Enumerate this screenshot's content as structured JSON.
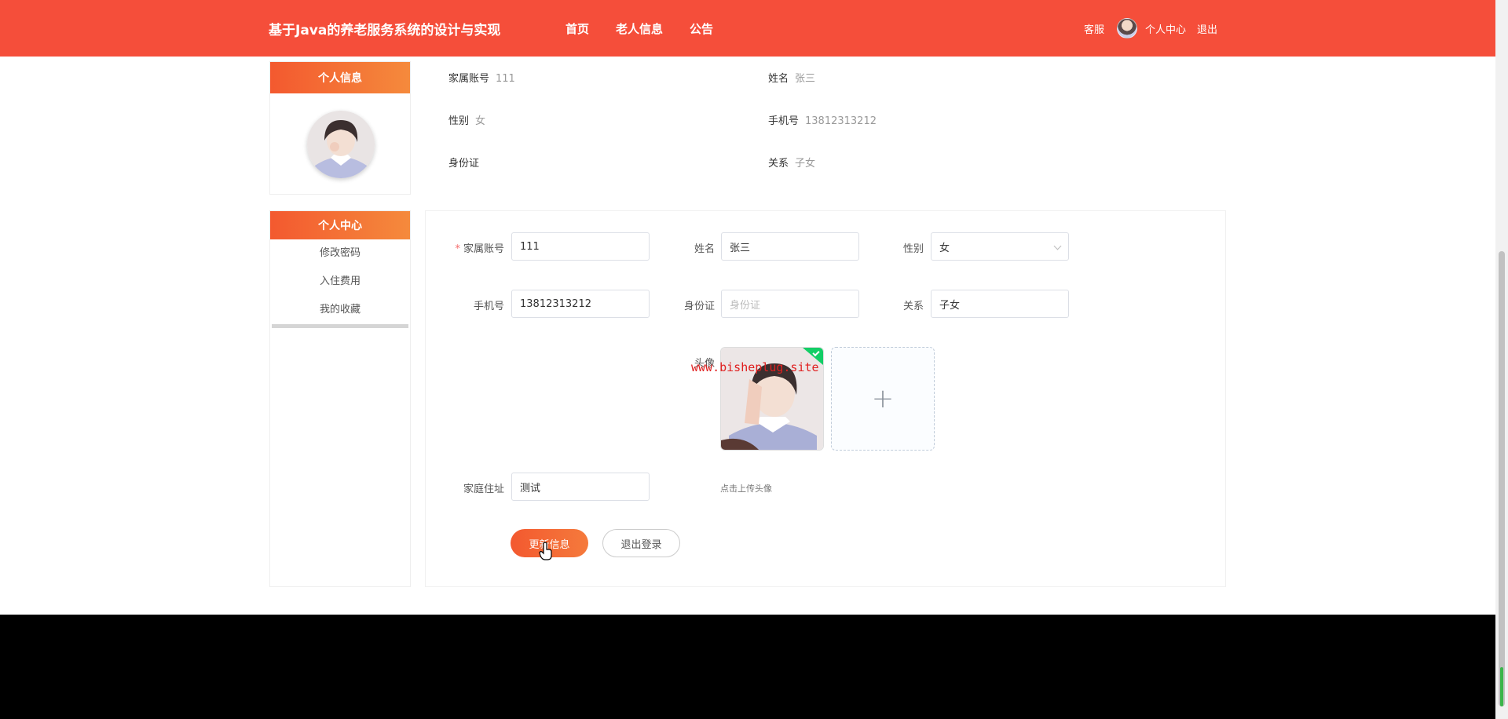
{
  "header": {
    "brand": "基于Java的养老服务系统的设计与实现",
    "nav": [
      "首页",
      "老人信息",
      "公告"
    ],
    "service": "客服",
    "user_center": "个人中心",
    "logout": "退出"
  },
  "profile_card": {
    "title": "个人信息"
  },
  "summary": {
    "account_label": "家属账号",
    "account_value": "111",
    "name_label": "姓名",
    "name_value": "张三",
    "gender_label": "性别",
    "gender_value": "女",
    "phone_label": "手机号",
    "phone_value": "13812313212",
    "id_label": "身份证",
    "id_value": "",
    "relation_label": "关系",
    "relation_value": "子女"
  },
  "menu": {
    "title": "个人中心",
    "items": [
      "修改密码",
      "入住费用",
      "我的收藏"
    ]
  },
  "form": {
    "required_mark": "*",
    "account_label": "家属账号",
    "account_value": "111",
    "name_label": "姓名",
    "name_value": "张三",
    "gender_label": "性别",
    "gender_value": "女",
    "phone_label": "手机号",
    "phone_value": "13812313212",
    "id_label": "身份证",
    "id_placeholder": "身份证",
    "relation_label": "关系",
    "relation_value": "子女",
    "avatar_label": "头像",
    "upload_plus": "+",
    "upload_tip": "点击上传头像",
    "address_label": "家庭住址",
    "address_value": "测试",
    "update_button": "更新信息",
    "logout_button": "退出登录"
  },
  "watermark": "www.bisheplug.site"
}
